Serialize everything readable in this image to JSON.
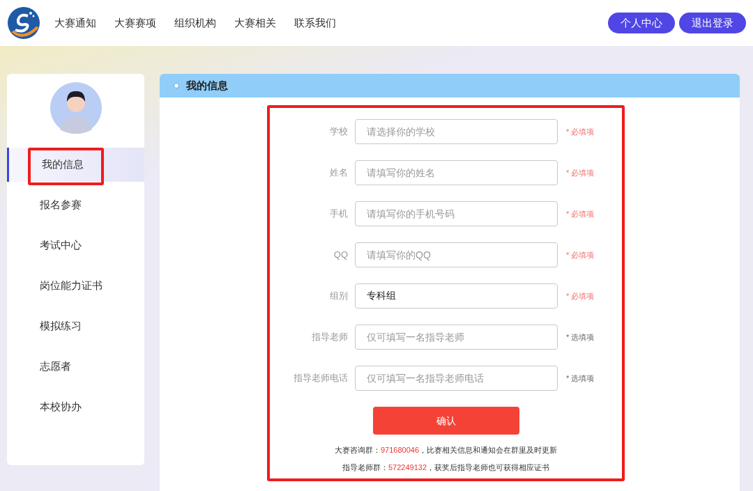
{
  "header": {
    "nav": [
      "大赛通知",
      "大赛赛项",
      "组织机构",
      "大赛相关",
      "联系我们"
    ],
    "buttons": [
      "个人中心",
      "退出登录"
    ]
  },
  "sidebar": {
    "items": [
      {
        "label": "我的信息",
        "selected": true,
        "highlighted": true
      },
      {
        "label": "报名参赛",
        "selected": false,
        "highlighted": false
      },
      {
        "label": "考试中心",
        "selected": false,
        "highlighted": false
      },
      {
        "label": "岗位能力证书",
        "selected": false,
        "highlighted": false
      },
      {
        "label": "模拟练习",
        "selected": false,
        "highlighted": false
      },
      {
        "label": "志愿者",
        "selected": false,
        "highlighted": false
      },
      {
        "label": "本校协办",
        "selected": false,
        "highlighted": false
      }
    ]
  },
  "panel": {
    "title": "我的信息",
    "highlighted": true,
    "fields": [
      {
        "label": "学校",
        "placeholder": "请选择你的学校",
        "kind": "required",
        "note": "* 必填项"
      },
      {
        "label": "姓名",
        "placeholder": "请填写你的姓名",
        "kind": "required",
        "note": "* 必填项"
      },
      {
        "label": "手机",
        "placeholder": "请填写你的手机号码",
        "kind": "required",
        "note": "* 必填项"
      },
      {
        "label": "QQ",
        "placeholder": "请填写你的QQ",
        "kind": "required",
        "note": "* 必填项"
      },
      {
        "label": "组别",
        "value": "专科组",
        "kind": "required",
        "note": "* 必填项"
      },
      {
        "label": "指导老师",
        "placeholder": "仅可填写一名指导老师",
        "kind": "optional",
        "note": "* 选填项"
      },
      {
        "label": "指导老师电话",
        "placeholder": "仅可填写一名指导老师电话",
        "kind": "optional",
        "note": "* 选填项"
      }
    ],
    "submit": "确认",
    "notes": [
      {
        "label": "大赛咨询群：",
        "number": "971680046",
        "rest": "，比赛相关信息和通知会在群里及时更新"
      },
      {
        "label": "指导老师群：",
        "number": "572249132",
        "rest": "，获奖后指导老师也可获得相应证书"
      }
    ]
  }
}
